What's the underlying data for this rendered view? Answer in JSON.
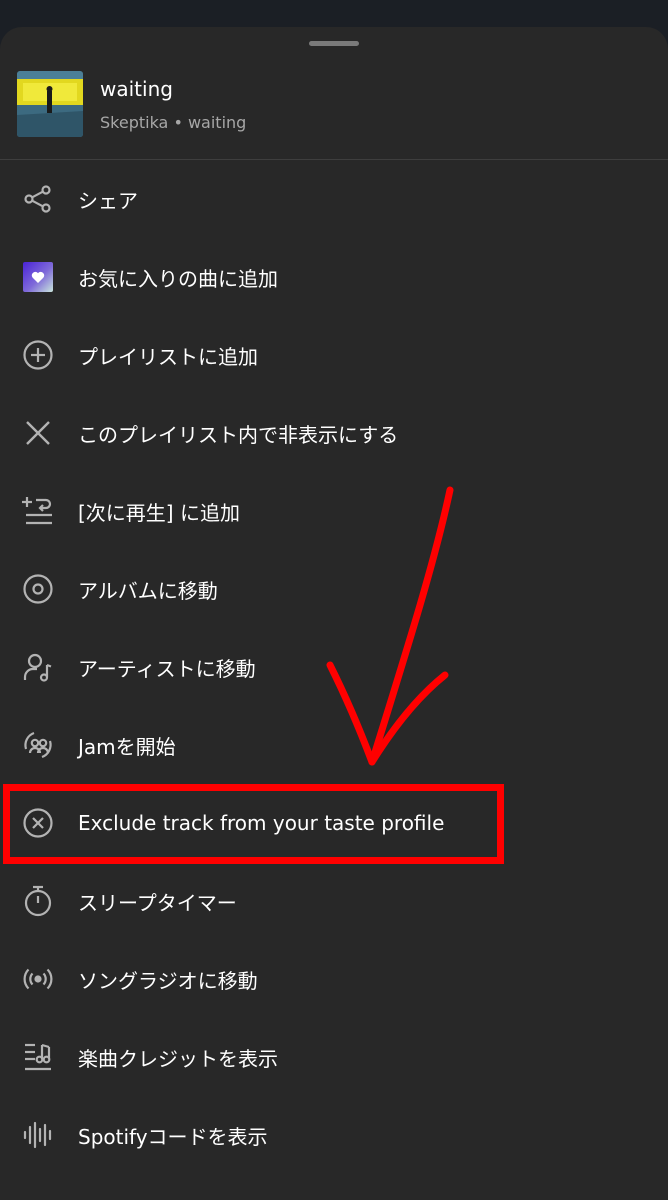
{
  "track": {
    "title": "waiting",
    "subtitle": "Skeptika • waiting"
  },
  "menu": {
    "items": [
      {
        "label": "シェア",
        "icon": "share-icon"
      },
      {
        "label": "お気に入りの曲に追加",
        "icon": "liked-songs-icon"
      },
      {
        "label": "プレイリストに追加",
        "icon": "plus-circle-icon"
      },
      {
        "label": "このプレイリスト内で非表示にする",
        "icon": "close-icon"
      },
      {
        "label": "[次に再生] に追加",
        "icon": "add-to-queue-icon"
      },
      {
        "label": "アルバムに移動",
        "icon": "album-icon"
      },
      {
        "label": "アーティストに移動",
        "icon": "artist-icon"
      },
      {
        "label": "Jamを開始",
        "icon": "jam-icon"
      },
      {
        "label": "Exclude track from your taste profile",
        "icon": "exclude-circle-icon"
      },
      {
        "label": "スリープタイマー",
        "icon": "timer-icon"
      },
      {
        "label": "ソングラジオに移動",
        "icon": "radio-icon"
      },
      {
        "label": "楽曲クレジットを表示",
        "icon": "credits-icon"
      },
      {
        "label": "Spotifyコードを表示",
        "icon": "spotify-code-icon"
      }
    ]
  },
  "colors": {
    "sheet_background": "#282828",
    "primary_text": "#ffffff",
    "secondary_text": "#a7a7a7",
    "annotation_red": "#ff0000"
  }
}
